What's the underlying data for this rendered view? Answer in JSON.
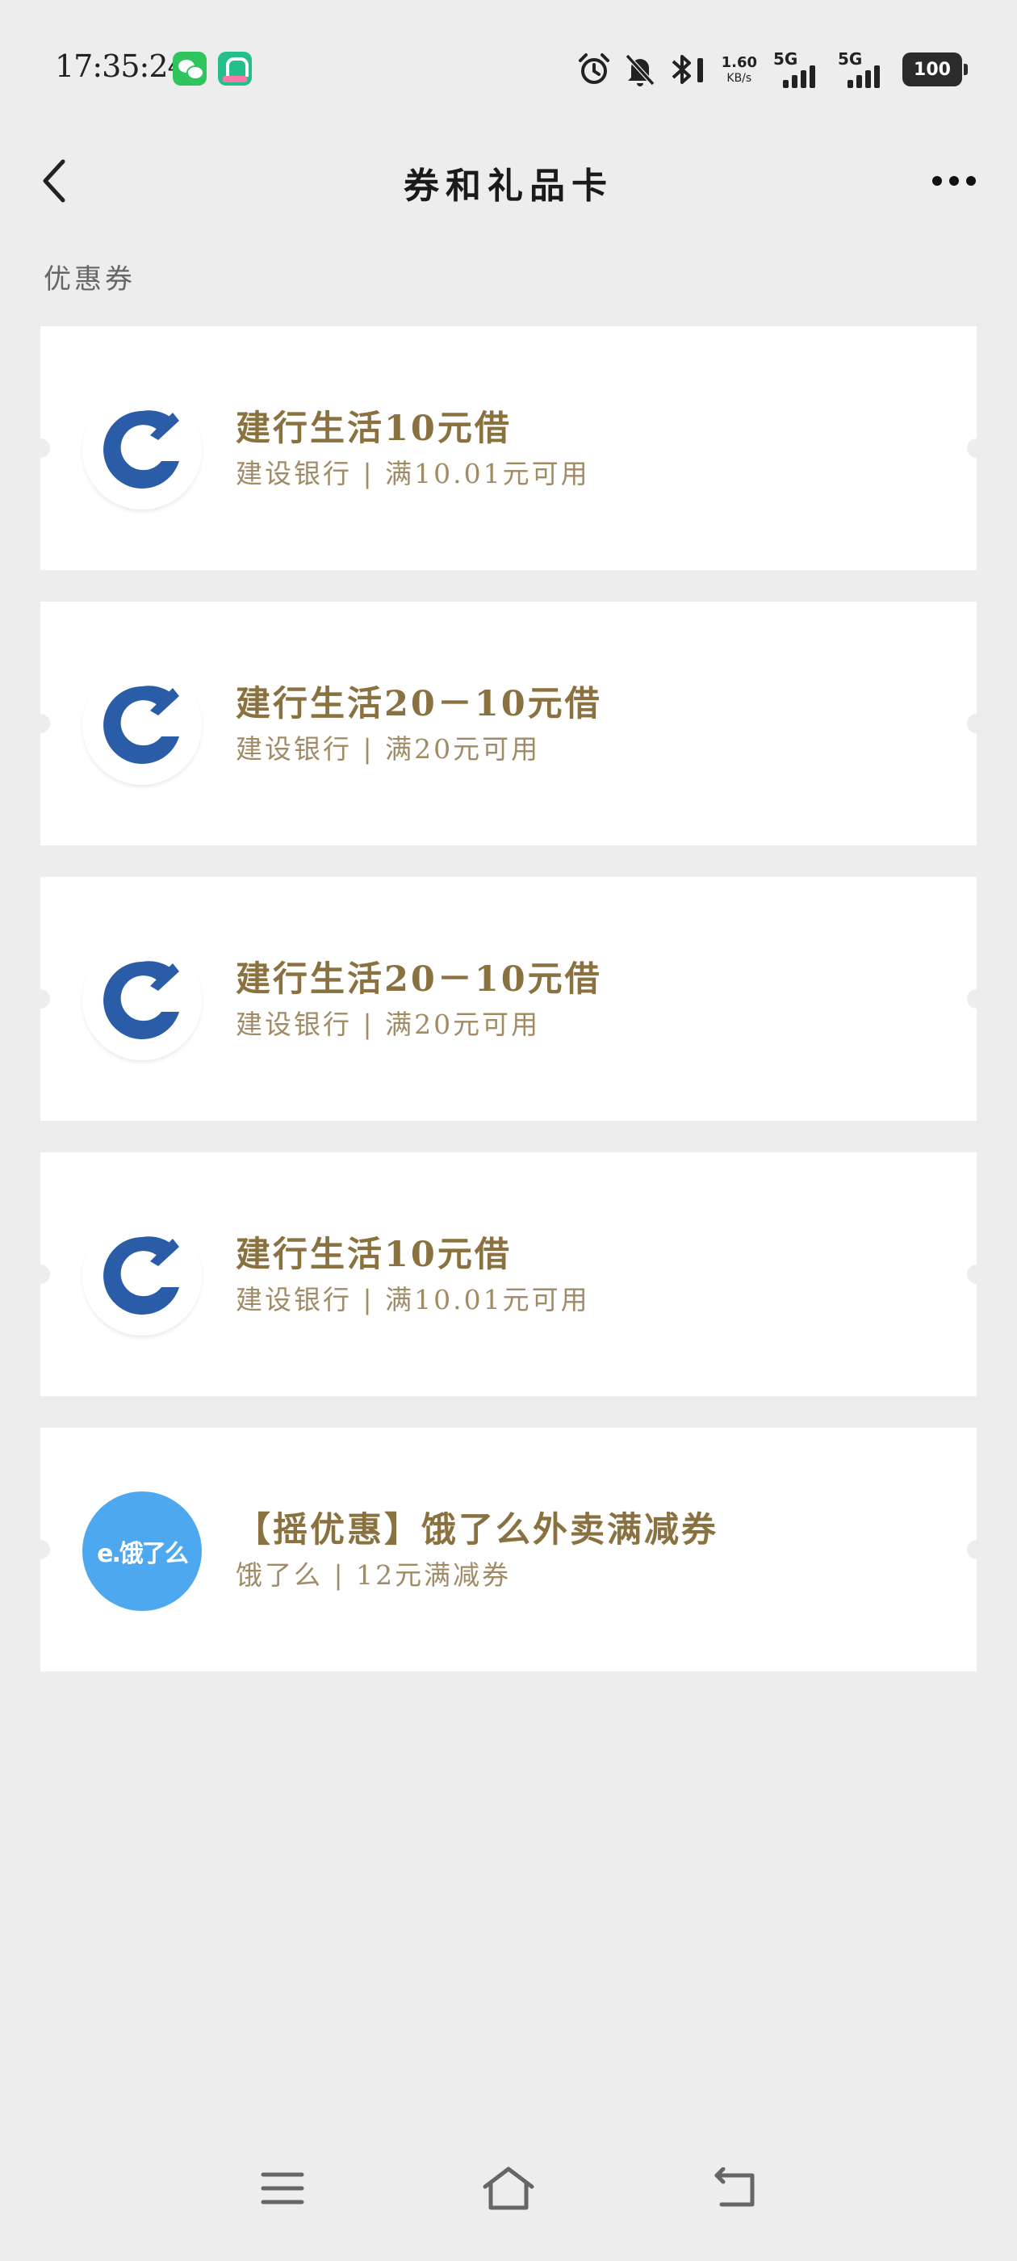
{
  "status_bar": {
    "time": "17:35:24",
    "net_speed_value": "1.60",
    "net_speed_unit": "KB/s",
    "sim1_label": "5G",
    "sim2_label": "5G",
    "battery": "100"
  },
  "header": {
    "title": "券和礼品卡"
  },
  "section": {
    "title": "优惠券"
  },
  "coupons": [
    {
      "title": "建行生活10元借",
      "subtitle": "建设银行 | 满10.01元可用",
      "logo": "ccb-logo"
    },
    {
      "title": "建行生活20－10元借",
      "subtitle": "建设银行 | 满20元可用",
      "logo": "ccb-logo"
    },
    {
      "title": "建行生活20－10元借",
      "subtitle": "建设银行 | 满20元可用",
      "logo": "ccb-logo"
    },
    {
      "title": "建行生活10元借",
      "subtitle": "建设银行 | 满10.01元可用",
      "logo": "ccb-logo"
    },
    {
      "title": "【摇优惠】饿了么外卖满减券",
      "subtitle": "饿了么 | 12元满减券",
      "logo": "eleme-logo",
      "logo_text": "e.饿了么"
    }
  ],
  "colors": {
    "background": "#ededed",
    "coupon_title": "#8a7140",
    "coupon_subtitle": "#a08b66",
    "ccb_blue": "#2a5ca8",
    "eleme_blue": "#4ea8f0"
  }
}
